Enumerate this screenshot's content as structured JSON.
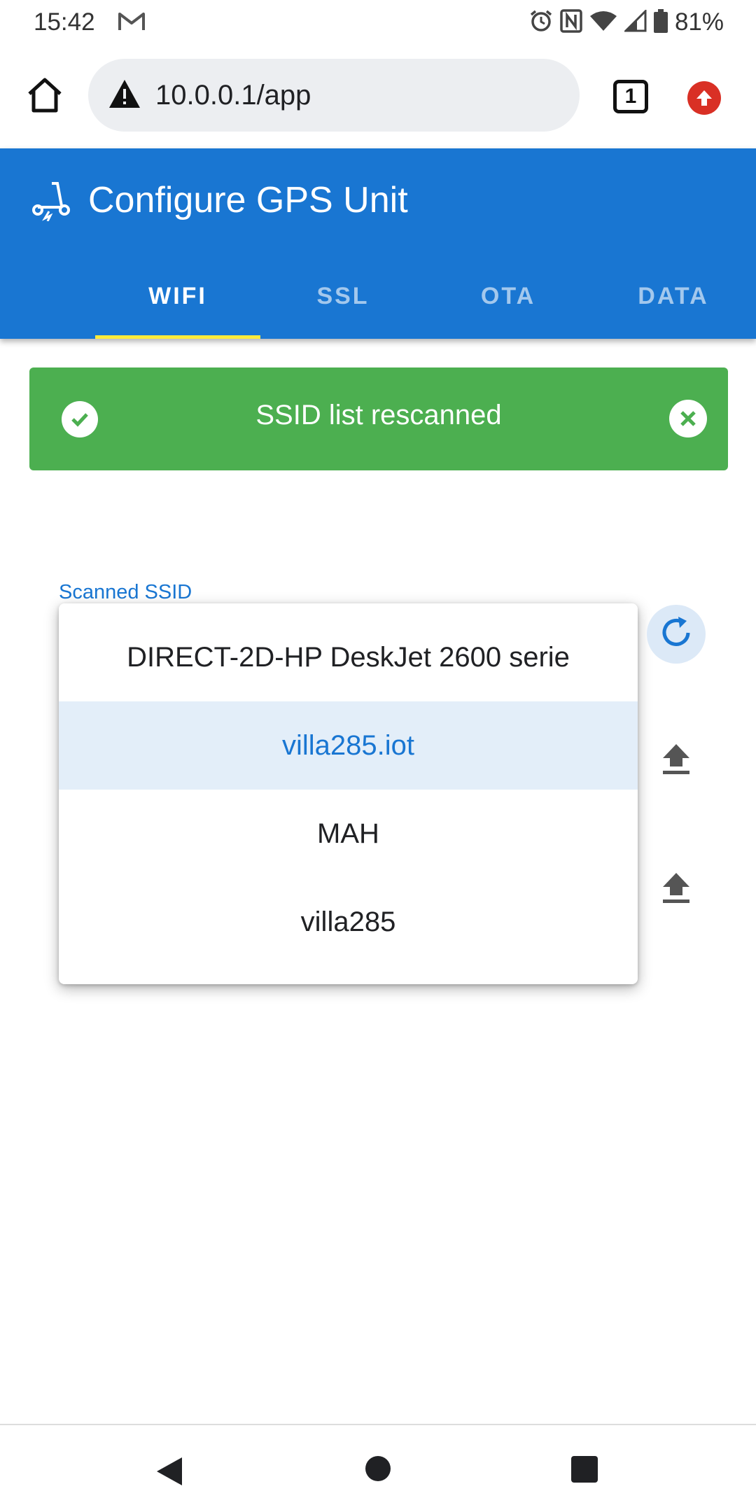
{
  "status_bar": {
    "time": "15:42",
    "battery": "81%",
    "icons": [
      "gmail-icon",
      "alarm-icon",
      "nfc-icon",
      "wifi-icon",
      "signal-icon",
      "battery-icon"
    ]
  },
  "browser": {
    "url": "10.0.0.1/app",
    "tab_count": "1"
  },
  "app": {
    "title": "Configure GPS Unit",
    "tabs": [
      {
        "label": "WIFI",
        "active": true
      },
      {
        "label": "SSL",
        "active": false
      },
      {
        "label": "OTA",
        "active": false
      },
      {
        "label": "DATA",
        "active": false
      }
    ]
  },
  "alert": {
    "message": "SSID list rescanned",
    "color": "#4caf50"
  },
  "ssid_field": {
    "label": "Scanned SSID",
    "options": [
      "DIRECT-2D-HP DeskJet 2600 serie",
      "villa285.iot",
      "MAH",
      "villa285"
    ],
    "selected": "villa285.iot"
  },
  "colors": {
    "primary": "#1976d2",
    "tab_indicator": "#ffeb3b",
    "success": "#4caf50"
  }
}
